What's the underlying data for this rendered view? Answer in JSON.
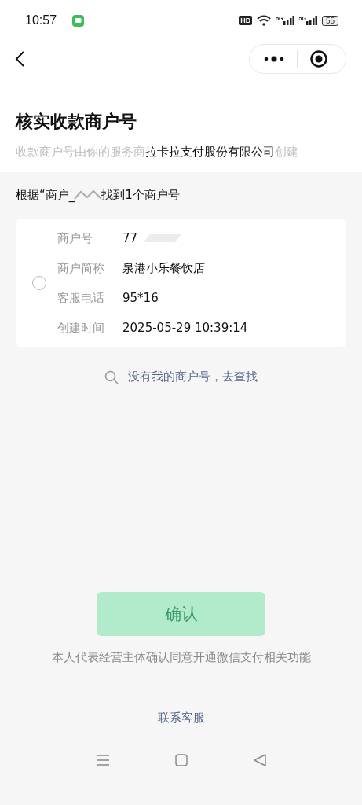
{
  "status_bar": {
    "time": "10:57",
    "hd_label": "HD",
    "signals": [
      "5G",
      "5G"
    ],
    "battery": "55"
  },
  "header": {
    "title": "核实收款商户号",
    "subtitle": {
      "before": "收款商户号由你的服务商",
      "provider": "拉卡拉支付股份有限公司",
      "after": "创建"
    }
  },
  "result": {
    "prefix": "根据“商户_",
    "suffix": "找到1个商户号"
  },
  "merchant": {
    "selected": false,
    "fields": [
      {
        "label": "商户号",
        "value": "77",
        "redacted": true
      },
      {
        "label": "商户简称",
        "value": "泉港小乐餐饮店",
        "redacted": false
      },
      {
        "label": "客服电话",
        "value": "95*16",
        "redacted": false
      },
      {
        "label": "创建时间",
        "value": "2025-05-29 10:39:14",
        "redacted": false
      }
    ]
  },
  "search_link": "没有我的商户号，去查找",
  "confirm": {
    "label": "确认",
    "disabled": true
  },
  "note": "本人代表经营主体确认同意开通微信支付相关功能",
  "contact_link": "联系客服"
}
